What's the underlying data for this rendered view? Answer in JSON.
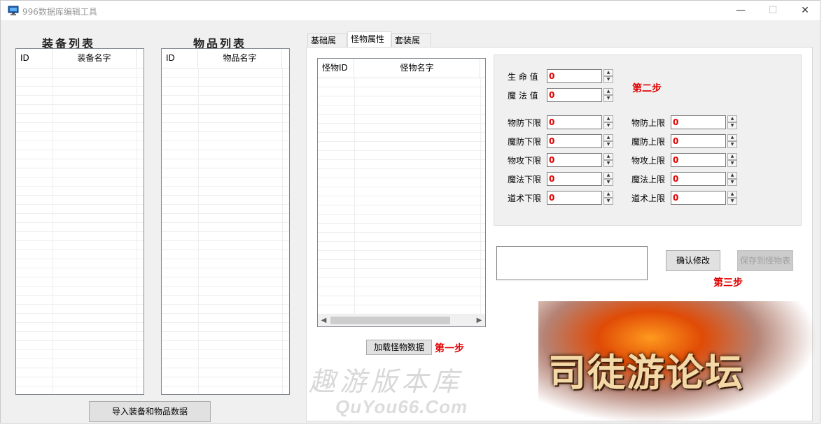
{
  "window": {
    "title": "996数据库编辑工具"
  },
  "titlebar_buttons": {
    "minimize": "—",
    "maximize": "☐",
    "close": "✕"
  },
  "equip_list": {
    "title": "装备列表",
    "columns": [
      "ID",
      "装备名字"
    ]
  },
  "item_list": {
    "title": "物品列表",
    "columns": [
      "ID",
      "物品名字"
    ]
  },
  "import_button": "导入装备和物品数据",
  "tabs": [
    "基础属性",
    "怪物属性",
    "套装属性"
  ],
  "active_tab": "怪物属性",
  "monster_list": {
    "columns": [
      "怪物ID",
      "怪物名字"
    ]
  },
  "load_button": "加载怪物数据",
  "step1": "第一步",
  "step2": "第二步",
  "step3": "第三步",
  "fields": {
    "hp": {
      "label": "生 命 值",
      "value": "0"
    },
    "mp": {
      "label": "魔 法 值",
      "value": "0"
    },
    "ac_min": {
      "label": "物防下限",
      "value": "0"
    },
    "ac_max": {
      "label": "物防上限",
      "value": "0"
    },
    "mac_min": {
      "label": "魔防下限",
      "value": "0"
    },
    "mac_max": {
      "label": "魔防上限",
      "value": "0"
    },
    "dc_min": {
      "label": "物攻下限",
      "value": "0"
    },
    "dc_max": {
      "label": "物攻上限",
      "value": "0"
    },
    "mc_min": {
      "label": "魔法下限",
      "value": "0"
    },
    "mc_max": {
      "label": "魔法上限",
      "value": "0"
    },
    "sc_min": {
      "label": "道术下限",
      "value": "0"
    },
    "sc_max": {
      "label": "道术上限",
      "value": "0"
    }
  },
  "confirm_button": "确认修改",
  "save_button": "保存到怪物表",
  "watermark": {
    "logo": "司徒游论坛",
    "site_cn": "趣游版本库",
    "site_en": "QuYou66.Com"
  },
  "colors": {
    "step_red": "#e00000",
    "value_red": "#e00000"
  }
}
